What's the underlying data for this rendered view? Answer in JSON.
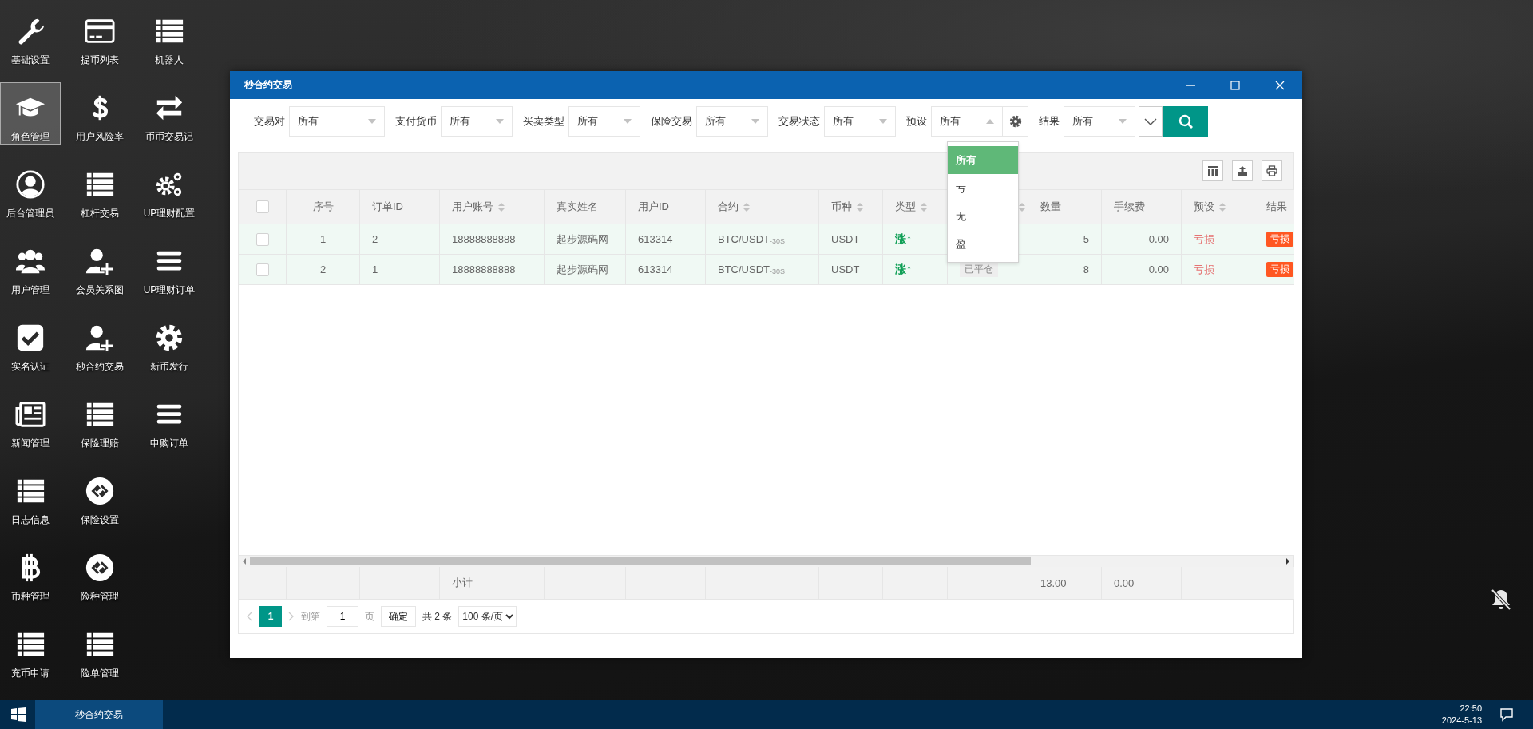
{
  "desktop_rows": [
    [
      {
        "label": "基础设置",
        "kind": "wrench",
        "selected": false
      },
      {
        "label": "提币列表",
        "kind": "card",
        "selected": false
      },
      {
        "label": "机器人",
        "kind": "list",
        "selected": false
      }
    ],
    [
      {
        "label": "角色管理",
        "kind": "cap",
        "selected": true
      },
      {
        "label": "用户风险率",
        "kind": "dollar",
        "selected": false
      },
      {
        "label": "币币交易记",
        "kind": "swap",
        "selected": false
      }
    ],
    [
      {
        "label": "后台管理员",
        "kind": "user-circle",
        "selected": false
      },
      {
        "label": "杠杆交易",
        "kind": "list",
        "selected": false
      },
      {
        "label": "UP理财配置",
        "kind": "gears",
        "selected": false
      }
    ],
    [
      {
        "label": "用户管理",
        "kind": "users",
        "selected": false
      },
      {
        "label": "会员关系图",
        "kind": "user-plus",
        "selected": false
      },
      {
        "label": "UP理财订单",
        "kind": "bars",
        "selected": false
      }
    ],
    [
      {
        "label": "实名认证",
        "kind": "check",
        "selected": false
      },
      {
        "label": "秒合约交易",
        "kind": "user-plus",
        "selected": false
      },
      {
        "label": "新币发行",
        "kind": "gear",
        "selected": false
      }
    ],
    [
      {
        "label": "新闻管理",
        "kind": "news",
        "selected": false
      },
      {
        "label": "保险理赔",
        "kind": "list",
        "selected": false
      },
      {
        "label": "申购订单",
        "kind": "bars",
        "selected": false
      }
    ],
    [
      {
        "label": "日志信息",
        "kind": "list",
        "selected": false
      },
      {
        "label": "保险设置",
        "kind": "link-circle",
        "selected": false
      }
    ],
    [
      {
        "label": "币种管理",
        "kind": "coin",
        "selected": false
      },
      {
        "label": "险种管理",
        "kind": "link-circle",
        "selected": false
      }
    ],
    [
      {
        "label": "充币申请",
        "kind": "list",
        "selected": false
      },
      {
        "label": "险单管理",
        "kind": "list",
        "selected": false
      }
    ]
  ],
  "window": {
    "title": "秒合约交易"
  },
  "filters": [
    {
      "label": "交易对",
      "value": "所有",
      "kind": "plain",
      "open": false
    },
    {
      "label": "支付货币",
      "value": "所有",
      "kind": "plain",
      "open": false
    },
    {
      "label": "买卖类型",
      "value": "所有",
      "kind": "plain",
      "open": false
    },
    {
      "label": "保险交易",
      "value": "所有",
      "kind": "plain",
      "open": false
    },
    {
      "label": "交易状态",
      "value": "所有",
      "kind": "plain",
      "open": false
    },
    {
      "label": "预设",
      "value": "所有",
      "kind": "with-settings",
      "open": true
    },
    {
      "label": "结果",
      "value": "所有",
      "kind": "plain",
      "open": false
    }
  ],
  "preset_options": [
    {
      "label": "所有",
      "selected": true
    },
    {
      "label": "亏",
      "selected": false
    },
    {
      "label": "无",
      "selected": false
    },
    {
      "label": "盈",
      "selected": false
    }
  ],
  "table": {
    "select_all_checked": false,
    "columns": [
      {
        "label": "序号",
        "sortable": false
      },
      {
        "label": "订单ID",
        "sortable": false
      },
      {
        "label": "用户账号",
        "sortable": true
      },
      {
        "label": "真实姓名",
        "sortable": false
      },
      {
        "label": "用户ID",
        "sortable": false
      },
      {
        "label": "合约",
        "sortable": true
      },
      {
        "label": "币种",
        "sortable": true
      },
      {
        "label": "类型",
        "sortable": true
      },
      {
        "sortable": true
      },
      {
        "label": "数量",
        "sortable": false
      },
      {
        "label": "手续费",
        "sortable": false
      },
      {
        "label": "预设",
        "sortable": true
      },
      {
        "label": "结果"
      }
    ],
    "rows": [
      {
        "checked": false,
        "index": "1",
        "order_id": "2",
        "account": "18888888888",
        "real_name": "起步源码网",
        "user_id": "613314",
        "contract": "BTC/USDT$_{-30S}$",
        "currency": "USDT",
        "type": "涨↑",
        "quantity": "5",
        "fee": "0.00",
        "preset": "亏损",
        "result": "亏损"
      },
      {
        "checked": false,
        "index": "2",
        "order_id": "1",
        "account": "18888888888",
        "real_name": "起步源码网",
        "user_id": "613314",
        "contract": "BTC/USDT$_{-30S}$",
        "currency": "USDT",
        "type": "涨↑",
        "status": "已平仓",
        "quantity": "8",
        "fee": "0.00",
        "preset": "亏损",
        "result": "亏损"
      }
    ],
    "totals": {
      "label": "小计",
      "quantity": "13.00",
      "fee": "0.00"
    }
  },
  "pagination": {
    "pages": [
      {
        "label": "1",
        "selected": true
      }
    ],
    "goto_label": "到第",
    "goto_value": "1",
    "page_unit": "页",
    "confirm": "确定",
    "total": "共 2 条",
    "page_size": "100 条/页"
  },
  "taskbar": {
    "tasks": [
      {
        "label": "秒合约交易",
        "selected": true
      }
    ],
    "time": "22:50",
    "date": "2024-5-13"
  }
}
